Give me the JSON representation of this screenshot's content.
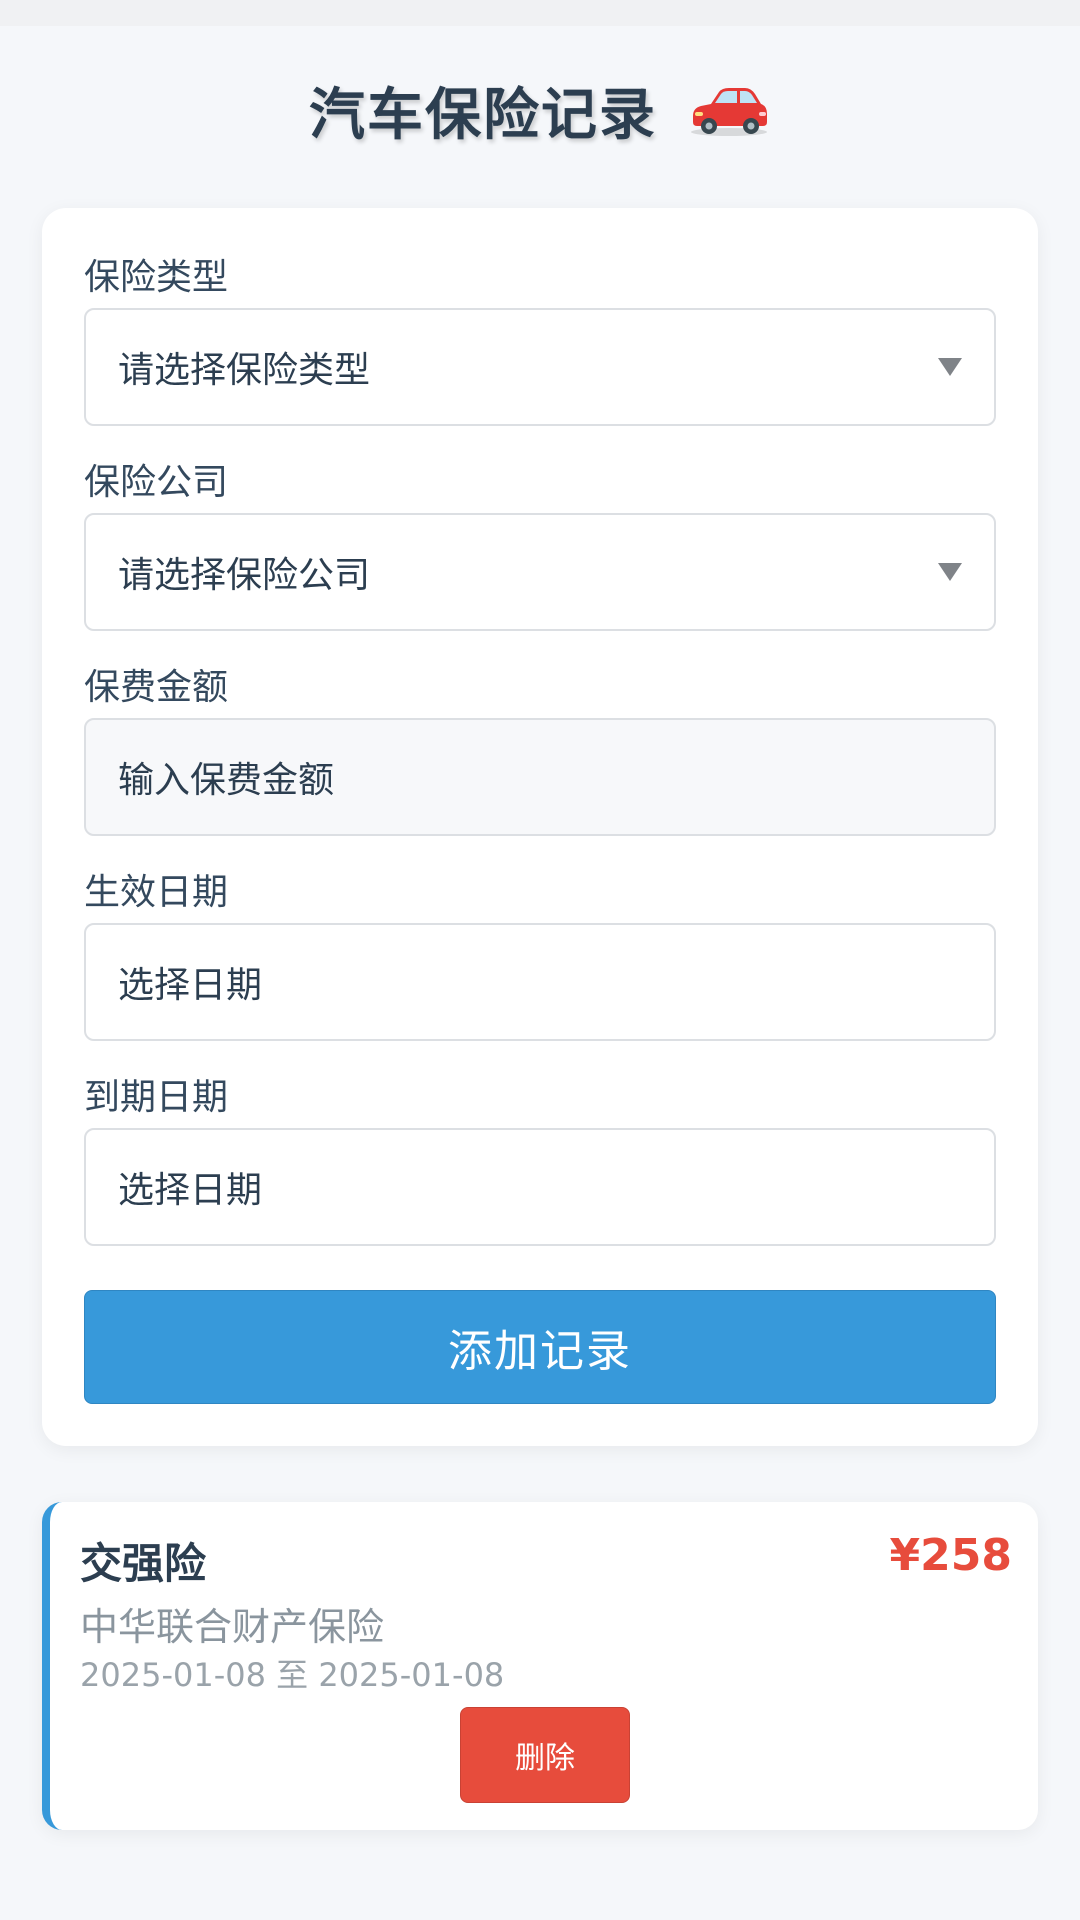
{
  "header": {
    "title": "汽车保险记录",
    "icon": "car-icon"
  },
  "form": {
    "type_label": "保险类型",
    "type_value": "请选择保险类型",
    "company_label": "保险公司",
    "company_value": "请选择保险公司",
    "amount_label": "保费金额",
    "amount_placeholder": "输入保费金额",
    "start_label": "生效日期",
    "start_value": "选择日期",
    "end_label": "到期日期",
    "end_value": "选择日期",
    "submit_label": "添加记录"
  },
  "records": [
    {
      "type": "交强险",
      "amount": "¥258",
      "company": "中华联合财产保险",
      "dates": "2025-01-08 至 2025-01-08",
      "delete_label": "删除"
    }
  ],
  "colors": {
    "accent": "#3799da",
    "danger": "#e74c3c",
    "title": "#2c3e50",
    "background": "#f5f7fa"
  }
}
